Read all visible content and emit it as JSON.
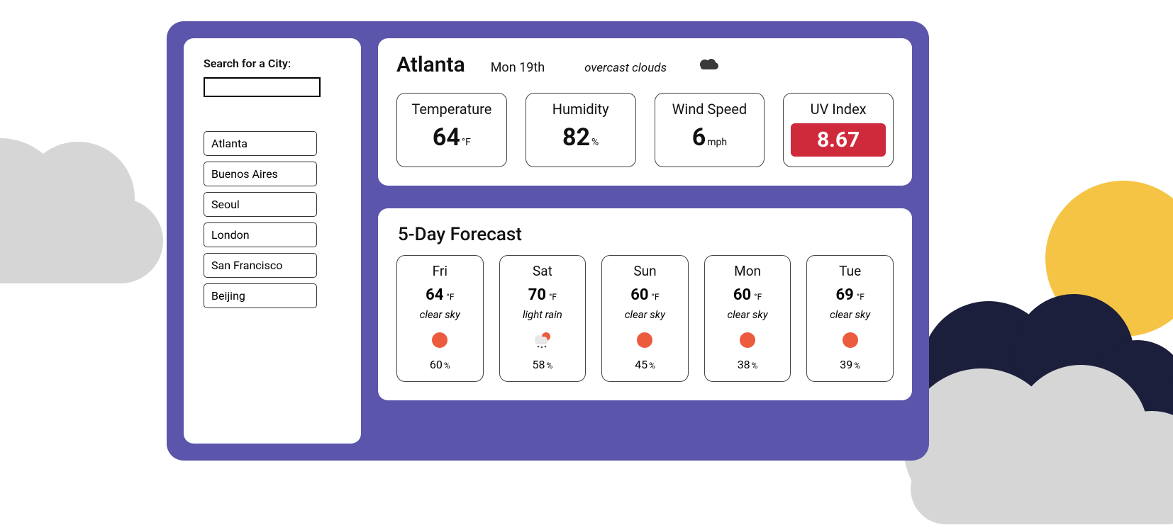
{
  "search": {
    "label": "Search for a City:",
    "value": ""
  },
  "history": [
    "Atlanta",
    "Buenos Aires",
    "Seoul",
    "London",
    "San Francisco",
    "Beijing"
  ],
  "current": {
    "city": "Atlanta",
    "date": "Mon 19th",
    "condition": "overcast clouds",
    "icon": "clouds-icon",
    "metrics": {
      "temperature": {
        "label": "Temperature",
        "value": "64",
        "unit": "°F"
      },
      "humidity": {
        "label": "Humidity",
        "value": "82",
        "unit": "%"
      },
      "wind": {
        "label": "Wind Speed",
        "value": "6",
        "unit": "mph"
      },
      "uv": {
        "label": "UV Index",
        "value": "8.67",
        "severity": "high",
        "severity_color": "#cf2a3b"
      }
    }
  },
  "forecast": {
    "title": "5-Day Forecast",
    "temp_unit": "°F",
    "humidity_unit": "%",
    "days": [
      {
        "name": "Fri",
        "temp": "64",
        "condition": "clear sky",
        "icon": "sun-icon",
        "humidity": "60"
      },
      {
        "name": "Sat",
        "temp": "70",
        "condition": "light rain",
        "icon": "rain-icon",
        "humidity": "58"
      },
      {
        "name": "Sun",
        "temp": "60",
        "condition": "clear sky",
        "icon": "sun-icon",
        "humidity": "45"
      },
      {
        "name": "Mon",
        "temp": "60",
        "condition": "clear sky",
        "icon": "sun-icon",
        "humidity": "38"
      },
      {
        "name": "Tue",
        "temp": "69",
        "condition": "clear sky",
        "icon": "sun-icon",
        "humidity": "39"
      }
    ]
  }
}
